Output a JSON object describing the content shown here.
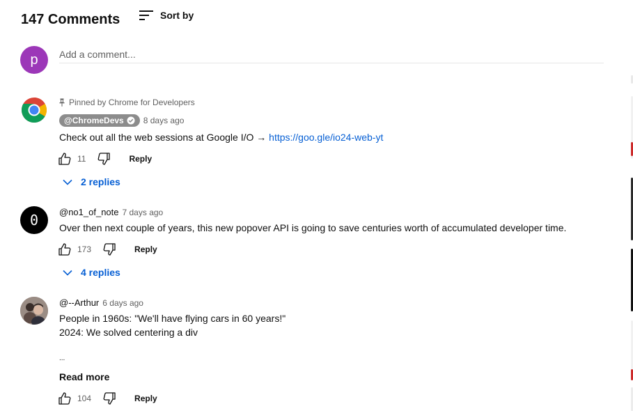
{
  "header": {
    "title": "147 Comments",
    "sort_label": "Sort by"
  },
  "composer": {
    "avatar_letter": "p",
    "placeholder": "Add a comment..."
  },
  "comments": [
    {
      "pinned_label": "Pinned by Chrome for Developers",
      "author": "@ChromeDevs",
      "verified": true,
      "time": "8 days ago",
      "text_prefix": "Check out all the web sessions at Google I/O → ",
      "link_text": "https://goo.gle/io24-web-yt",
      "likes": "11",
      "reply_label": "Reply",
      "replies_label": "2 replies"
    },
    {
      "avatar_glyph": "0",
      "author": "@no1_of_note",
      "time": "7 days ago",
      "text": "Over then next couple of years, this new popover API is going to save centuries worth of accumulated developer time.",
      "likes": "173",
      "reply_label": "Reply",
      "replies_label": "4 replies"
    },
    {
      "author": "@--Arthur",
      "time": "6 days ago",
      "line1": "People in 1960s: \"We'll have flying cars in 60 years!\"",
      "line2": "2024: We solved centering a div",
      "ellipsis": "...",
      "read_more": "Read more",
      "likes": "104",
      "reply_label": "Reply"
    }
  ],
  "icons": [
    "sort-icon",
    "pin-icon",
    "verified-icon",
    "like-icon",
    "dislike-icon",
    "chevron-down-icon",
    "chrome-logo-icon"
  ],
  "colors": {
    "link": "#065fd4",
    "composer_avatar": "#9c37b8",
    "chip": "#8c8c8c"
  }
}
